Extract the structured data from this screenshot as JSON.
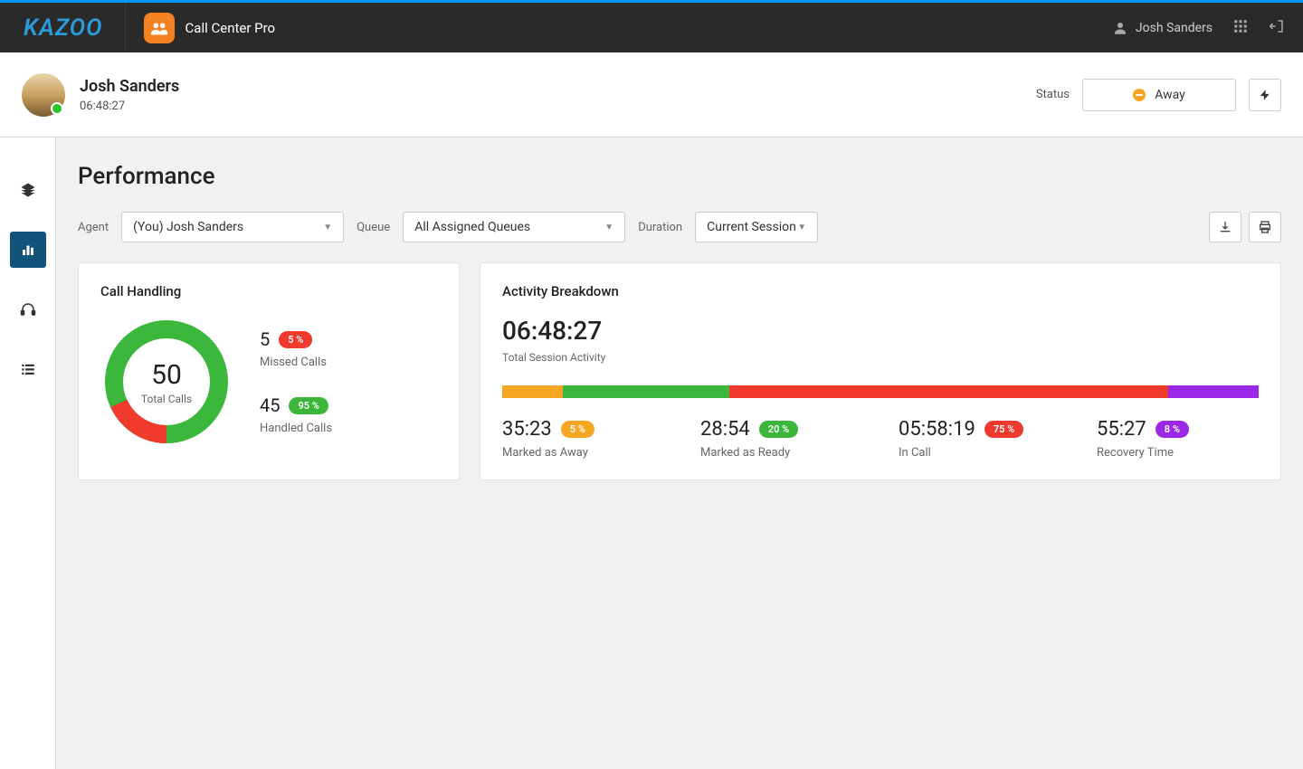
{
  "header": {
    "logo": "KAZOO",
    "app_title": "Call Center Pro",
    "user_name": "Josh Sanders"
  },
  "subheader": {
    "user_name": "Josh Sanders",
    "session_time": "06:48:27",
    "status_label": "Status",
    "status_value": "Away"
  },
  "page": {
    "title": "Performance"
  },
  "filters": {
    "agent_label": "Agent",
    "agent_value": "(You) Josh Sanders",
    "queue_label": "Queue",
    "queue_value": "All Assigned Queues",
    "duration_label": "Duration",
    "duration_value": "Current Session"
  },
  "call_handling": {
    "title": "Call Handling",
    "total_value": "50",
    "total_label": "Total Calls",
    "missed": {
      "value": "5",
      "pct": "5 %",
      "label": "Missed Calls"
    },
    "handled": {
      "value": "45",
      "pct": "95 %",
      "label": "Handled Calls"
    }
  },
  "activity": {
    "title": "Activity Breakdown",
    "total_time": "06:48:27",
    "total_label": "Total Session Activity",
    "segments": {
      "away": {
        "value": "35:23",
        "pct": "5 %",
        "label": "Marked as Away",
        "width": "8%"
      },
      "ready": {
        "value": "28:54",
        "pct": "20 %",
        "label": "Marked as Ready",
        "width": "22%"
      },
      "incall": {
        "value": "05:58:19",
        "pct": "75 %",
        "label": "In Call",
        "width": "58%"
      },
      "recovery": {
        "value": "55:27",
        "pct": "8 %",
        "label": "Recovery Time",
        "width": "12%"
      }
    }
  },
  "chart_data": {
    "type": "pie",
    "series": [
      {
        "name": "Handled Calls",
        "value": 45,
        "pct": 95,
        "color": "#3bb73b"
      },
      {
        "name": "Missed Calls",
        "value": 5,
        "pct": 5,
        "color": "#ef3a2d"
      }
    ],
    "total": 50,
    "title": "Call Handling"
  }
}
